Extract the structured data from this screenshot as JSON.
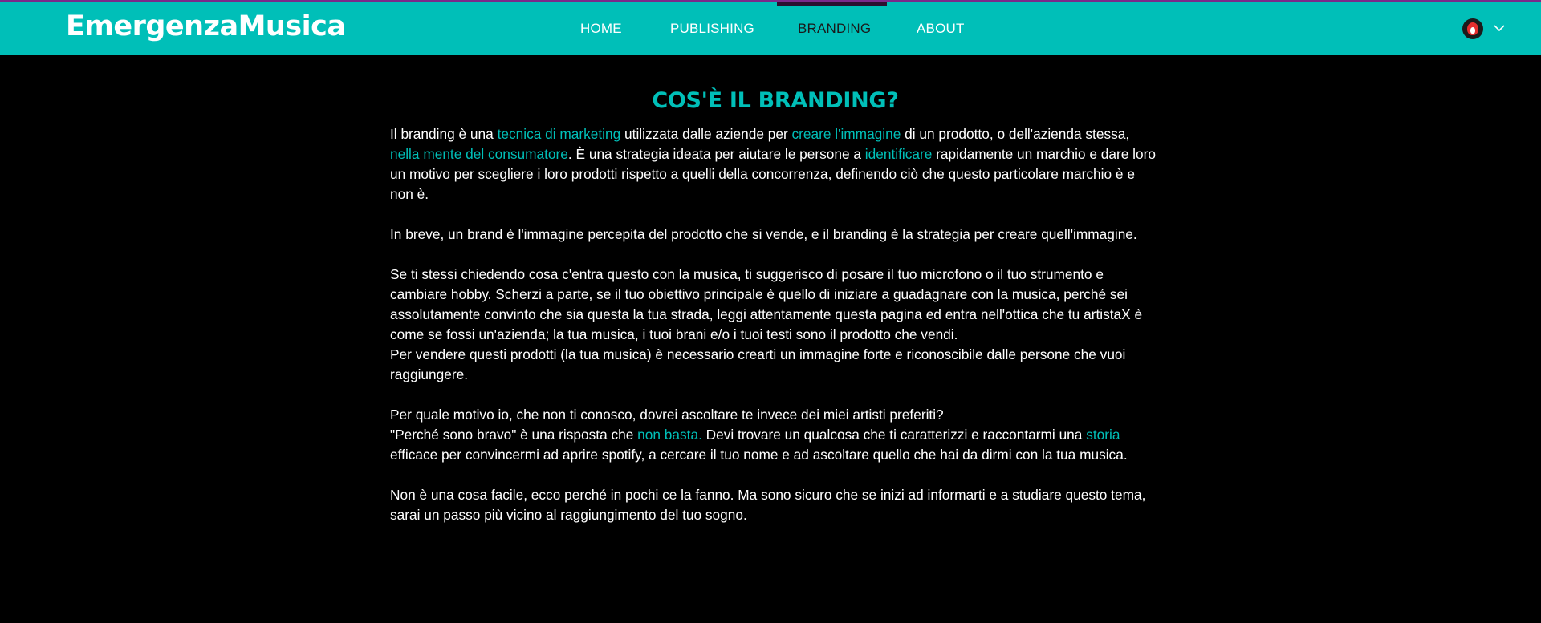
{
  "header": {
    "logo": "EmergenzaMusica",
    "nav": [
      {
        "label": "HOME"
      },
      {
        "label": "PUBLISHING"
      },
      {
        "label": "BRANDING"
      },
      {
        "label": "ABOUT"
      }
    ],
    "active_tab": "BRANDING",
    "accent_color": "#00bfb8",
    "top_border_color": "#7a2a8a"
  },
  "main": {
    "title": "COS'È IL BRANDING?",
    "p1": {
      "t1": "Il branding è una ",
      "l1": "tecnica di marketing",
      "t2": " utilizzata dalle aziende per ",
      "l2": "creare l'immagine",
      "t3": " di un prodotto, o dell'azienda stessa, ",
      "l3": "nella mente del consumatore",
      "t4": ". È una strategia ideata per aiutare le persone a ",
      "l4": "identificare",
      "t5": " rapidamente un marchio e dare loro un motivo per scegliere i loro prodotti rispetto a quelli della concorrenza, definendo ciò che questo particolare marchio è e non è."
    },
    "p2": "In breve, un brand è l'immagine percepita del prodotto che si vende, e il branding è la strategia per creare quell'immagine.",
    "p3": {
      "line1": "Se ti stessi chiedendo cosa c'entra questo con la musica, ti suggerisco di posare il tuo microfono o il tuo strumento e cambiare hobby. Scherzi a parte, se il tuo obiettivo principale è quello di iniziare a guadagnare con la musica, perché sei assolutamente convinto che sia questa la tua strada, leggi attentamente questa pagina ed entra nell'ottica che tu artistaX è come se fossi un'azienda; la tua musica, i tuoi brani e/o i tuoi testi sono il prodotto che vendi.",
      "line2": "Per vendere questi prodotti (la tua musica) è necessario crearti un immagine forte e riconoscibile dalle persone che vuoi raggiungere."
    },
    "p4": {
      "line1": "Per quale motivo io, che non ti conosco, dovrei ascoltare te invece dei miei artisti preferiti?",
      "t1": "\"Perché sono bravo\" è una risposta che ",
      "l1": "non basta.",
      "t2": " Devi trovare un qualcosa che ti caratterizzi e raccontarmi una ",
      "l2": "storia",
      "t3": " efficace per convincermi ad aprire spotify, a cercare il tuo nome e ad ascoltare quello che hai da dirmi con la tua musica."
    },
    "p5": "Non è una cosa facile, ecco perché in pochi ce la fanno. Ma sono sicuro che se inizi ad informarti e a studiare questo tema, sarai un passo più vicino al raggiungimento del tuo sogno."
  }
}
